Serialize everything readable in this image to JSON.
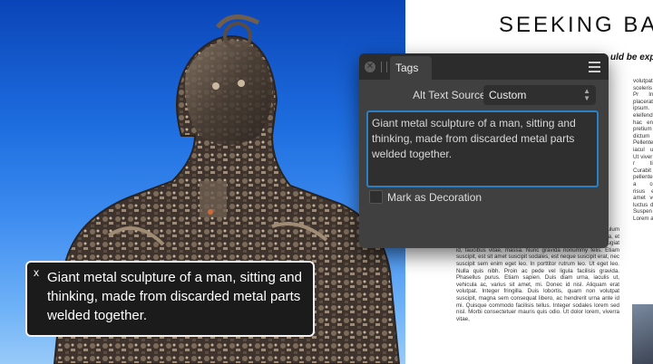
{
  "document": {
    "title": "SEEKING BA",
    "subtitle": "uld be expe",
    "column_main": "tortor. Aenean ut nibh. Nullam hendrerit viverra dolor. Vestibulum fringilla, lectus id viverra malesuada, enim mi adipiscing ligula, et bibendum lacus lectus id sem. Cras risus turpis, varius ac, feugiat id, faucibus vitae, massa. Nunc gravida nonummy felis. Etiam suscipit, est sit amet suscipit sodales, est neque suscipit erat, nec suscipit sem enim eget leo. In porttitor rutrum leo. Ut eget leo. Nulla quis nibh. Proin ac pede vel ligula facilisis gravida. Phasellus purus. Etiam sapien. Duis diam urna, iaculis ut, vehicula ac, varius sit amet, mi. Donec id nisl. Aliquam erat volutpat. Integer fringilla. Duis lobortis, quam non volutpat suscipit, magna sem consequat libero, ac hendrerit urna ante id mi. Quisque commodo facilisis tellus. Integer sodales lorem sed nisl. Morbi consectetuer mauris quis odio. Ut dolor lorem, viverra vitae,",
    "column_right": "volutpat mattis sceleris felis. Pr In mi placerat ipsum. eleifend In hac enim vit pretium dictum Pellente id, iacul ultricies Ut viver mattis r tincidun Curabit pellente Class a conubia risus es sit amet volutpat luctus d id pe Suspen Lorem adipisci"
  },
  "panel": {
    "tab_label": "Tags",
    "alt_source_label": "Alt Text Source:",
    "alt_source_value": "Custom",
    "alt_text": "Giant metal sculpture of a man, sitting and thinking, made from discarded metal parts welded together.",
    "decoration_label": "Mark as Decoration",
    "decoration_checked": false,
    "accent_color": "#2a80c7"
  },
  "tooltip": {
    "close_glyph": "x",
    "text": "Giant metal sculpture of a man, sitting and thinking, made from discarded metal parts welded together."
  },
  "icons": [
    "close-icon",
    "grip-icon",
    "menu-icon",
    "chevron-updown-icon"
  ]
}
